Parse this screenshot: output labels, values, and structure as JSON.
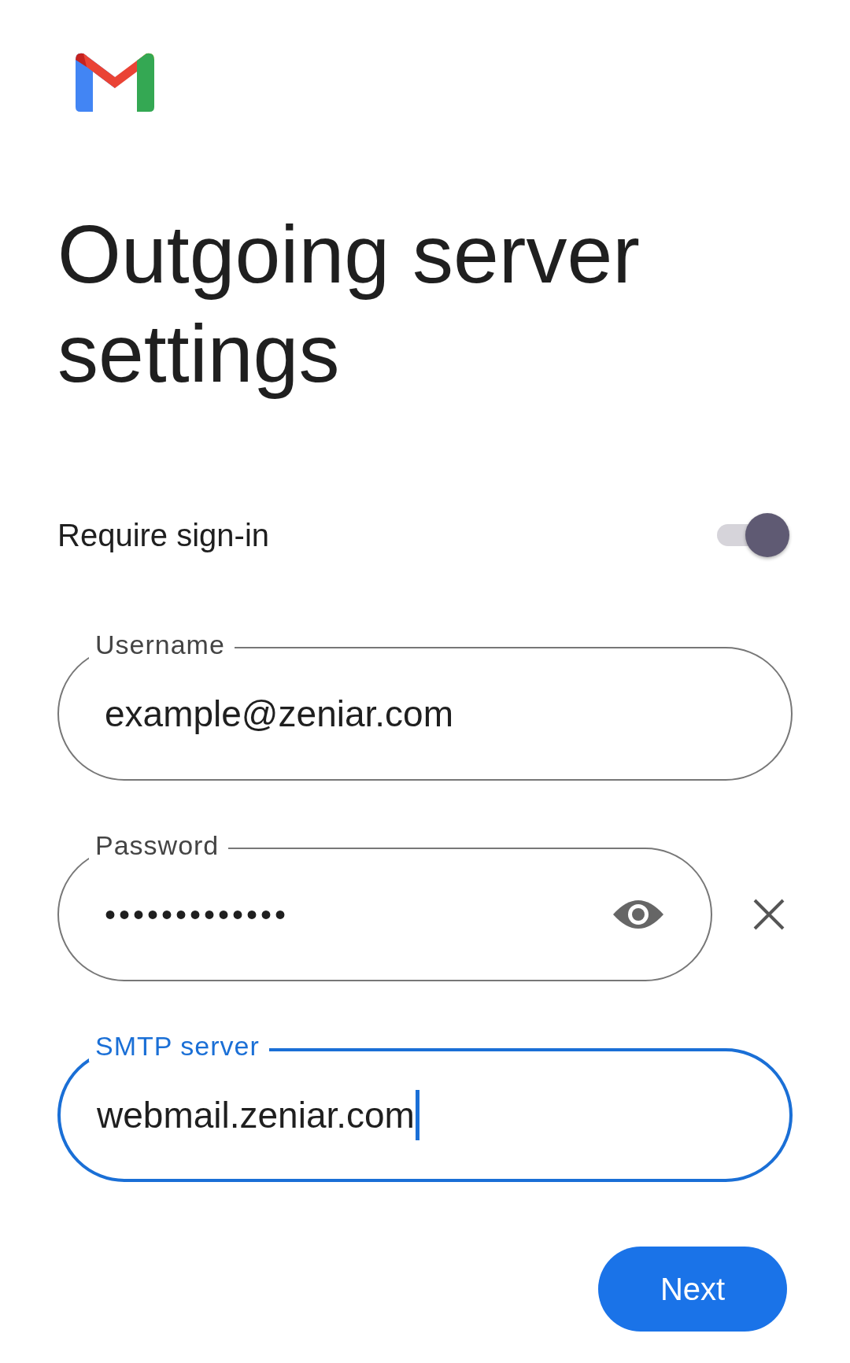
{
  "title": "Outgoing server settings",
  "require_sign_in": {
    "label": "Require sign-in",
    "on": true
  },
  "fields": [
    {
      "kind": "text",
      "label": "Username",
      "value": "example@zeniar.com",
      "focused": false
    },
    {
      "kind": "password",
      "label": "Password",
      "value": "•••••••••••••",
      "focused": false
    },
    {
      "kind": "text",
      "label": "SMTP server",
      "value": "webmail.zeniar.com",
      "focused": true
    }
  ],
  "buttons": [
    {
      "label": "Next"
    }
  ]
}
